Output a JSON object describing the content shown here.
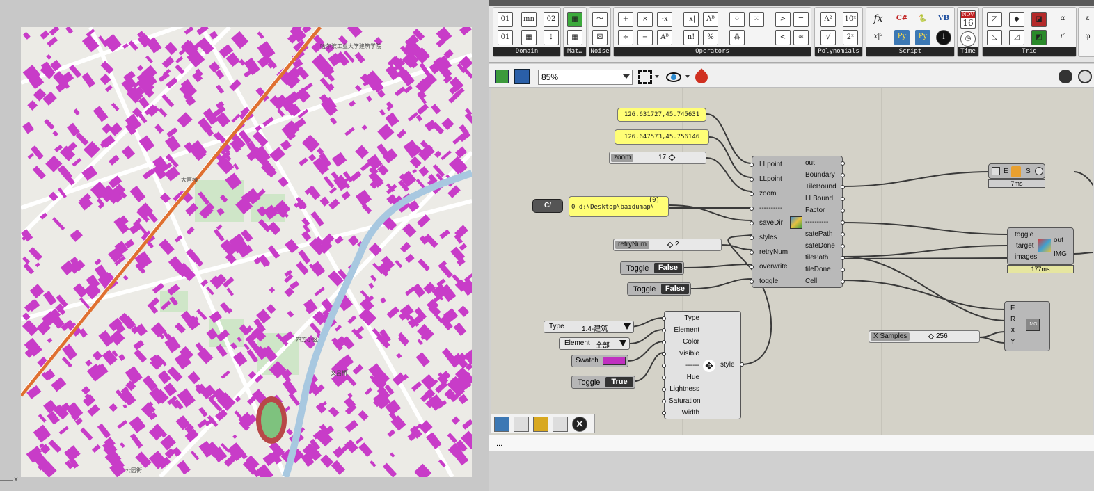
{
  "map": {
    "labels": [
      "哈尔滨工业大学建筑学院",
      "大直桥",
      "四方小区",
      "文昌桥",
      "公园街"
    ],
    "axis_label": "x"
  },
  "ribbon": {
    "groups": [
      "Domain",
      "Mat…",
      "Noise",
      "Operators",
      "Polynomials",
      "Script",
      "Time",
      "Trig"
    ],
    "calendar_month": "NOV",
    "calendar_day": "16"
  },
  "toolbar": {
    "zoom": "85%"
  },
  "panels": {
    "pt1": "126.631727,45.745631",
    "pt2": "126.647573,45.756146",
    "path_index": "{0}",
    "path_value": "0 d:\\Desktop\\baidumap\\"
  },
  "sliders": {
    "zoom_label": "zoom",
    "zoom_value": "17",
    "retry_label": "retryNum",
    "retry_value": "2",
    "samples_label": "X Samples",
    "samples_value": "256"
  },
  "toggles": {
    "overwrite_label": "Toggle",
    "overwrite_value": "False",
    "toggle_label": "Toggle",
    "toggle_value": "False",
    "style_toggle_label": "Toggle",
    "style_toggle_value": "True"
  },
  "c_button": "C/",
  "main_comp": {
    "inputs": [
      "LLpoint",
      "LLpoint",
      "zoom",
      "----------",
      "saveDir",
      "styles",
      "retryNum",
      "overwrite",
      "toggle"
    ],
    "outputs": [
      "out",
      "Boundary",
      "TileBound",
      "LLBound",
      "Factor",
      "----------",
      "satePath",
      "sateDone",
      "tilePath",
      "tileDone",
      "Cell"
    ]
  },
  "style_comp": {
    "inputs": [
      "Type",
      "Element",
      "Color",
      "Visible",
      "------",
      "Hue",
      "Lightness",
      "Saturation",
      "Width"
    ],
    "output": "style"
  },
  "dropdowns": {
    "type_label": "Type",
    "type_value": "1.4-建筑",
    "element_label": "Element",
    "element_value": "全部"
  },
  "swatch_label": "Swatch",
  "fetch_comp": {
    "E": "E",
    "S": "S",
    "time": "7ms"
  },
  "img_comp": {
    "inputs": [
      "toggle",
      "target",
      "images"
    ],
    "output1": "out",
    "output2": "IMG",
    "time": "177ms"
  },
  "image_comp": {
    "inputs": [
      "F",
      "R",
      "X",
      "Y"
    ],
    "icon": "IMG"
  },
  "status": "...",
  "colors": {
    "building": "#c83cc8",
    "panel": "#fffe76",
    "river": "#a8c8e0",
    "rail": "#e07030"
  }
}
